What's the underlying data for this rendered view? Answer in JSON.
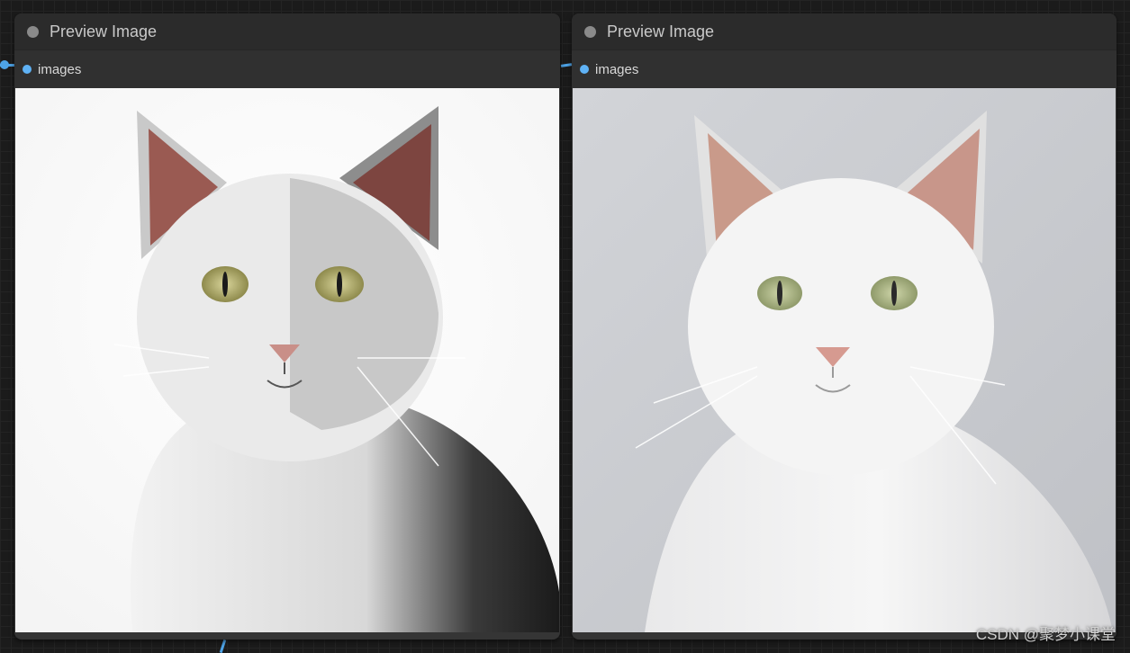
{
  "nodes": [
    {
      "title": "Preview Image",
      "input_label": "images",
      "image_alt": "white cat on white background"
    },
    {
      "title": "Preview Image",
      "input_label": "images",
      "image_alt": "white cat on grey background"
    }
  ],
  "watermark": "CSDN @聚梦小课堂",
  "colors": {
    "canvas_bg": "#1b1b1b",
    "node_bg": "#353535",
    "header_bg": "#2b2b2b",
    "slot_dot": "#5fb2f5",
    "link": "#4ea3e6"
  }
}
